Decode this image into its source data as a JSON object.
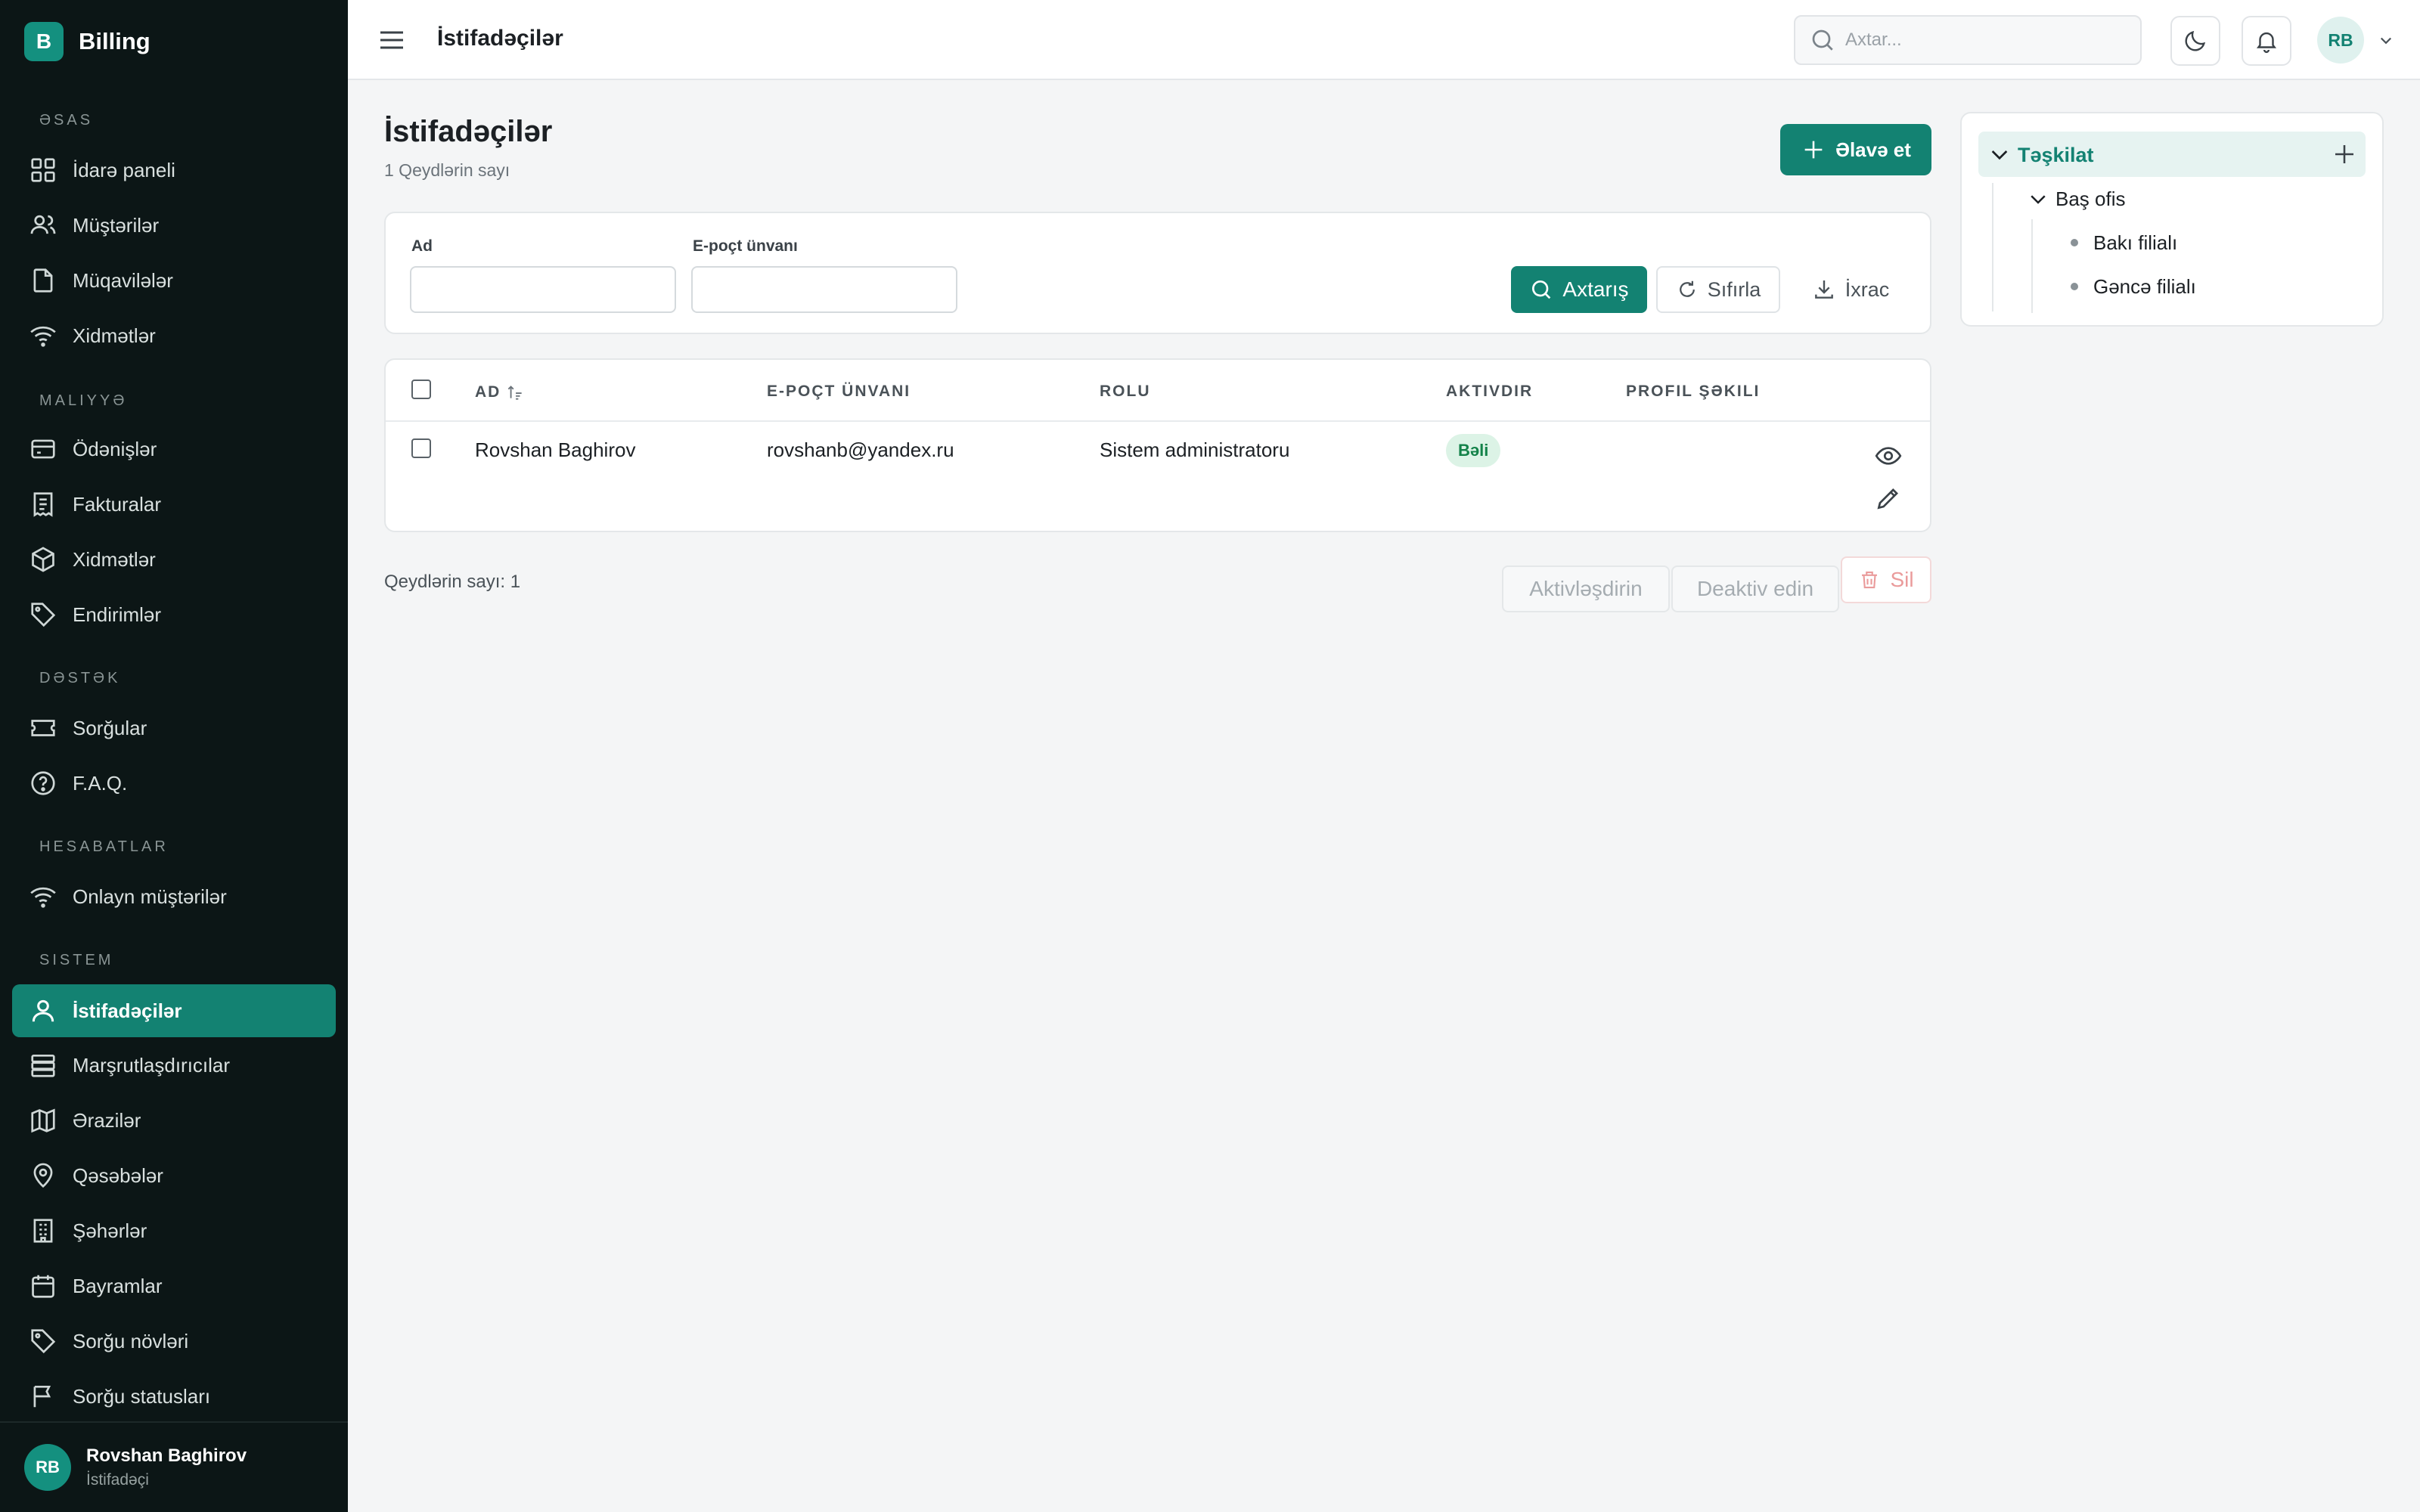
{
  "sidebar": {
    "brand_letter": "B",
    "brand_name": "Billing",
    "sections": [
      {
        "title": "ƏSAS",
        "items": [
          {
            "label": "İdarə paneli",
            "icon": "dashboard-icon"
          },
          {
            "label": "Müştərilər",
            "icon": "users-icon"
          },
          {
            "label": "Müqavilələr",
            "icon": "document-icon"
          },
          {
            "label": "Xidmətlər",
            "icon": "wifi-icon"
          }
        ]
      },
      {
        "title": "MALIYYƏ",
        "items": [
          {
            "label": "Ödənişlər",
            "icon": "credit-card-icon"
          },
          {
            "label": "Fakturalar",
            "icon": "receipt-icon"
          },
          {
            "label": "Xidmətlər",
            "icon": "box-icon"
          },
          {
            "label": "Endirimlər",
            "icon": "tag-icon"
          }
        ]
      },
      {
        "title": "DƏSTƏK",
        "items": [
          {
            "label": "Sorğular",
            "icon": "ticket-icon"
          },
          {
            "label": "F.A.Q.",
            "icon": "help-circle-icon"
          }
        ]
      },
      {
        "title": "HESABATLAR",
        "items": [
          {
            "label": "Onlayn müştərilər",
            "icon": "wifi-icon"
          }
        ]
      },
      {
        "title": "SISTEM",
        "items": [
          {
            "label": "İstifadəçilər",
            "icon": "user-icon",
            "active": true
          },
          {
            "label": "Marşrutlaşdırıcılar",
            "icon": "server-icon"
          },
          {
            "label": "Ərazilər",
            "icon": "map-icon"
          },
          {
            "label": "Qəsəbələr",
            "icon": "map-pin-icon"
          },
          {
            "label": "Şəhərlər",
            "icon": "building-icon"
          },
          {
            "label": "Bayramlar",
            "icon": "calendar-icon"
          },
          {
            "label": "Sorğu növləri",
            "icon": "tag-icon"
          },
          {
            "label": "Sorğu statusları",
            "icon": "flag-icon"
          }
        ]
      }
    ],
    "user": {
      "initials": "RB",
      "name": "Rovshan Baghirov",
      "role": "İstifadəçi"
    }
  },
  "topbar": {
    "title": "İstifadəçilər",
    "search_placeholder": "Axtar...",
    "user_initials": "RB"
  },
  "main": {
    "title": "İstifadəçilər",
    "subtitle": "1 Qeydlərin sayı",
    "add_button": "Əlavə et",
    "filters": {
      "name_label": "Ad",
      "name_value": "",
      "email_label": "E-poçt ünvanı",
      "email_value": "",
      "search_button": "Axtarış",
      "reset_button": "Sıfırla",
      "export_button": "İxrac"
    },
    "table": {
      "columns": [
        "AD",
        "E-POÇT ÜNVANI",
        "ROLU",
        "AKTIVDIR",
        "PROFIL ŞƏKILI"
      ],
      "rows": [
        {
          "name": "Rovshan Baghirov",
          "email": "rovshanb@yandex.ru",
          "role": "Sistem administratoru",
          "active": "Bəli"
        }
      ]
    },
    "record_count": "Qeydlərin sayı: 1",
    "bulk": {
      "activate": "Aktivləşdirin",
      "deactivate": "Deaktiv edin",
      "delete": "Sil"
    }
  },
  "org_tree": {
    "root": "Təşkilat",
    "child": "Baş ofis",
    "leaves": [
      "Bakı filialı",
      "Gəncə filialı"
    ]
  },
  "colors": {
    "accent": "#138272",
    "sidebar_bg": "#0c1616",
    "badge_bg": "#dcf3e6",
    "danger": "#ea9b9b"
  }
}
